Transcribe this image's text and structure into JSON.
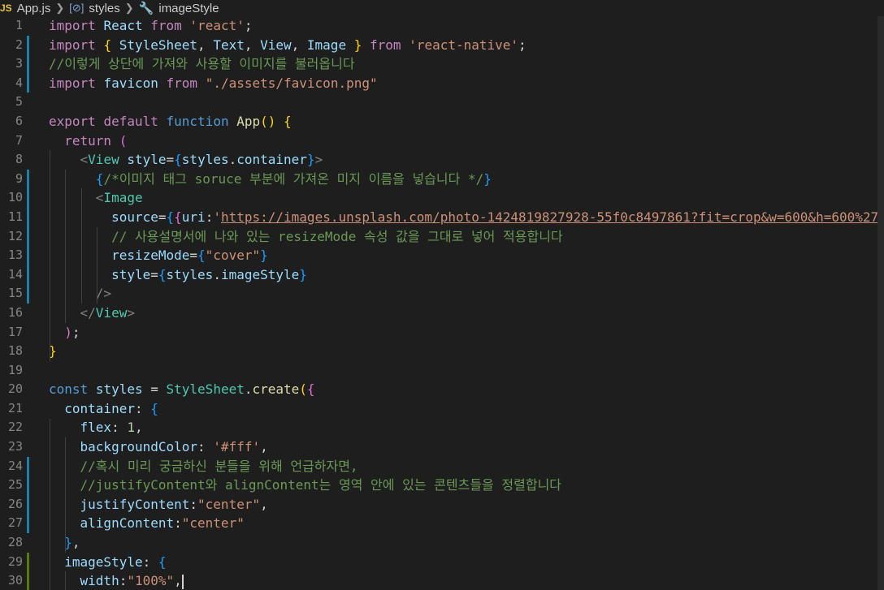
{
  "breadcrumb": {
    "lang_badge": "JS",
    "file": "App.js",
    "symbol1": "styles",
    "symbol2": "imageStyle"
  },
  "lines": [
    {
      "n": "1",
      "t": [
        [
          "kw2",
          "import"
        ],
        [
          "p",
          " "
        ],
        [
          "id",
          "React"
        ],
        [
          "p",
          " "
        ],
        [
          "kw2",
          "from"
        ],
        [
          "p",
          " "
        ],
        [
          "str",
          "'react'"
        ],
        [
          "p",
          ";"
        ]
      ]
    },
    {
      "n": "2",
      "t": [
        [
          "kw2",
          "import"
        ],
        [
          "p",
          " "
        ],
        [
          "brY",
          "{"
        ],
        [
          "p",
          " "
        ],
        [
          "id",
          "StyleSheet"
        ],
        [
          "p",
          ", "
        ],
        [
          "id",
          "Text"
        ],
        [
          "p",
          ", "
        ],
        [
          "id",
          "View"
        ],
        [
          "p",
          ", "
        ],
        [
          "id",
          "Image"
        ],
        [
          "p",
          " "
        ],
        [
          "brY",
          "}"
        ],
        [
          "p",
          " "
        ],
        [
          "kw2",
          "from"
        ],
        [
          "p",
          " "
        ],
        [
          "str",
          "'react-native'"
        ],
        [
          "p",
          ";"
        ]
      ]
    },
    {
      "n": "3",
      "t": [
        [
          "cm",
          "//이렇게 상단에 가져와 사용할 이미지를 불러옵니다"
        ]
      ]
    },
    {
      "n": "4",
      "t": [
        [
          "kw2",
          "import"
        ],
        [
          "p",
          " "
        ],
        [
          "id",
          "favicon"
        ],
        [
          "p",
          " "
        ],
        [
          "kw2",
          "from"
        ],
        [
          "p",
          " "
        ],
        [
          "str",
          "\"./assets/favicon.png\""
        ]
      ]
    },
    {
      "n": "5",
      "t": []
    },
    {
      "n": "6",
      "t": [
        [
          "kw2",
          "export"
        ],
        [
          "p",
          " "
        ],
        [
          "kw2",
          "default"
        ],
        [
          "p",
          " "
        ],
        [
          "kw",
          "function"
        ],
        [
          "p",
          " "
        ],
        [
          "fn",
          "App"
        ],
        [
          "brY",
          "()"
        ],
        [
          "p",
          " "
        ],
        [
          "brY",
          "{"
        ]
      ]
    },
    {
      "n": "7",
      "t": [
        [
          "p",
          "  "
        ],
        [
          "kw2",
          "return"
        ],
        [
          "p",
          " "
        ],
        [
          "br",
          "("
        ]
      ]
    },
    {
      "n": "8",
      "t": [
        [
          "p",
          "    "
        ],
        [
          "pn",
          "<"
        ],
        [
          "tag",
          "View"
        ],
        [
          "p",
          " "
        ],
        [
          "id",
          "style"
        ],
        [
          "p",
          "="
        ],
        [
          "brB",
          "{"
        ],
        [
          "id",
          "styles"
        ],
        [
          "p",
          "."
        ],
        [
          "id",
          "container"
        ],
        [
          "brB",
          "}"
        ],
        [
          "pn",
          ">"
        ]
      ]
    },
    {
      "n": "9",
      "t": [
        [
          "p",
          "      "
        ],
        [
          "brB",
          "{"
        ],
        [
          "cm",
          "/*이미지 태그 soruce 부분에 가져온 미지 이름을 넣습니다 */"
        ],
        [
          "brB",
          "}"
        ]
      ]
    },
    {
      "n": "10",
      "t": [
        [
          "p",
          "      "
        ],
        [
          "pn",
          "<"
        ],
        [
          "tag",
          "Image"
        ]
      ]
    },
    {
      "n": "11",
      "t": [
        [
          "p",
          "        "
        ],
        [
          "id",
          "source"
        ],
        [
          "p",
          "="
        ],
        [
          "brB",
          "{"
        ],
        [
          "br",
          "{"
        ],
        [
          "id",
          "uri"
        ],
        [
          "p",
          ":"
        ],
        [
          "str",
          "'"
        ],
        [
          "str-u",
          "https://images.unsplash.com/photo-1424819827928-55f0c8497861?fit=crop&w=600&h=600%27"
        ]
      ]
    },
    {
      "n": "12",
      "t": [
        [
          "p",
          "        "
        ],
        [
          "cm",
          "// 사용설명서에 나와 있는 resizeMode 속성 값을 그대로 넣어 적용합니다"
        ]
      ]
    },
    {
      "n": "13",
      "t": [
        [
          "p",
          "        "
        ],
        [
          "id",
          "resizeMode"
        ],
        [
          "p",
          "="
        ],
        [
          "brB",
          "{"
        ],
        [
          "str",
          "\"cover\""
        ],
        [
          "brB",
          "}"
        ]
      ]
    },
    {
      "n": "14",
      "t": [
        [
          "p",
          "        "
        ],
        [
          "id",
          "style"
        ],
        [
          "p",
          "="
        ],
        [
          "brB",
          "{"
        ],
        [
          "id",
          "styles"
        ],
        [
          "p",
          "."
        ],
        [
          "id",
          "imageStyle"
        ],
        [
          "brB",
          "}"
        ]
      ]
    },
    {
      "n": "15",
      "t": [
        [
          "p",
          "      "
        ],
        [
          "pn",
          "/>"
        ]
      ]
    },
    {
      "n": "16",
      "t": [
        [
          "p",
          "    "
        ],
        [
          "pn",
          "</"
        ],
        [
          "tag",
          "View"
        ],
        [
          "pn",
          ">"
        ]
      ]
    },
    {
      "n": "17",
      "t": [
        [
          "p",
          "  "
        ],
        [
          "br",
          ")"
        ],
        [
          "p",
          ";"
        ]
      ]
    },
    {
      "n": "18",
      "t": [
        [
          "brY",
          "}"
        ]
      ]
    },
    {
      "n": "19",
      "t": []
    },
    {
      "n": "20",
      "t": [
        [
          "kw",
          "const"
        ],
        [
          "p",
          " "
        ],
        [
          "id",
          "styles"
        ],
        [
          "p",
          " = "
        ],
        [
          "cls",
          "StyleSheet"
        ],
        [
          "p",
          "."
        ],
        [
          "fn",
          "create"
        ],
        [
          "brY",
          "("
        ],
        [
          "br",
          "{"
        ]
      ]
    },
    {
      "n": "21",
      "t": [
        [
          "p",
          "  "
        ],
        [
          "id",
          "container"
        ],
        [
          "p",
          ": "
        ],
        [
          "brB",
          "{"
        ]
      ]
    },
    {
      "n": "22",
      "t": [
        [
          "p",
          "    "
        ],
        [
          "id",
          "flex"
        ],
        [
          "p",
          ": "
        ],
        [
          "num",
          "1"
        ],
        [
          "p",
          ","
        ]
      ]
    },
    {
      "n": "23",
      "t": [
        [
          "p",
          "    "
        ],
        [
          "id",
          "backgroundColor"
        ],
        [
          "p",
          ": "
        ],
        [
          "str",
          "'#fff'"
        ],
        [
          "p",
          ","
        ]
      ]
    },
    {
      "n": "24",
      "t": [
        [
          "p",
          "    "
        ],
        [
          "cm",
          "//혹시 미리 궁금하신 분들을 위해 언급하자면,"
        ]
      ]
    },
    {
      "n": "25",
      "t": [
        [
          "p",
          "    "
        ],
        [
          "cm",
          "//justifyContent와 alignContent는 영역 안에 있는 콘텐츠들을 정렬합니다"
        ]
      ]
    },
    {
      "n": "26",
      "t": [
        [
          "p",
          "    "
        ],
        [
          "id",
          "justifyContent"
        ],
        [
          "p",
          ":"
        ],
        [
          "str",
          "\"center\""
        ],
        [
          "p",
          ","
        ]
      ]
    },
    {
      "n": "27",
      "t": [
        [
          "p",
          "    "
        ],
        [
          "id",
          "alignContent"
        ],
        [
          "p",
          ":"
        ],
        [
          "str",
          "\"center\""
        ]
      ]
    },
    {
      "n": "28",
      "t": [
        [
          "p",
          "  "
        ],
        [
          "brB",
          "}"
        ],
        [
          "p",
          ","
        ]
      ]
    },
    {
      "n": "29",
      "t": [
        [
          "p",
          "  "
        ],
        [
          "id",
          "imageStyle"
        ],
        [
          "p",
          ": "
        ],
        [
          "brB",
          "{"
        ]
      ]
    },
    {
      "n": "30",
      "t": [
        [
          "p",
          "    "
        ],
        [
          "id",
          "width"
        ],
        [
          "p",
          ":"
        ],
        [
          "str",
          "\"100%\""
        ],
        [
          "p",
          ","
        ]
      ]
    }
  ]
}
